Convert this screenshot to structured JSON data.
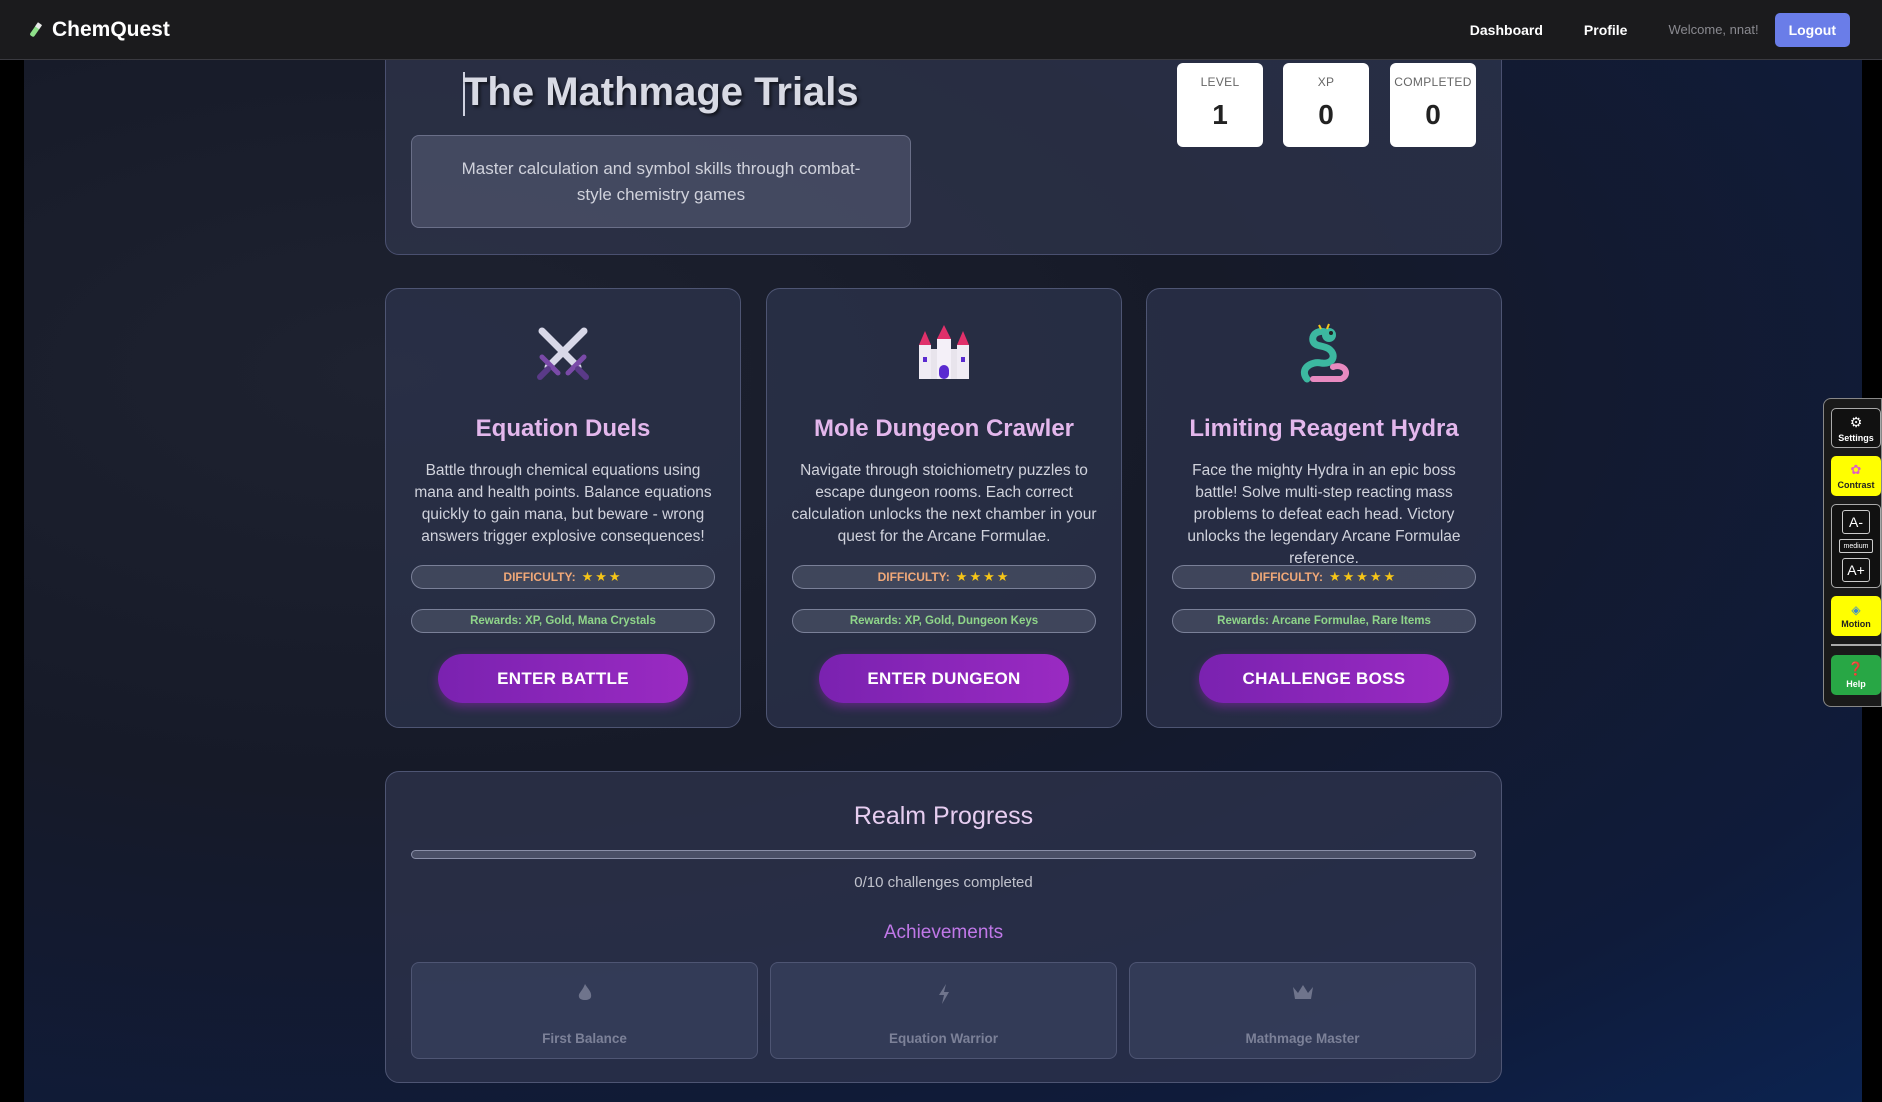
{
  "nav": {
    "brand": "ChemQuest",
    "links": [
      "Dashboard",
      "Profile"
    ],
    "welcome": "Welcome, nnat!",
    "logout": "Logout"
  },
  "header": {
    "title": "The Mathmage Trials",
    "subtitle": "Master calculation and symbol skills through combat-style chemistry games",
    "stats": [
      {
        "label": "LEVEL",
        "value": "1"
      },
      {
        "label": "XP",
        "value": "0"
      },
      {
        "label": "COMPLETED",
        "value": "0"
      }
    ]
  },
  "cards": [
    {
      "icon": "crossed-swords-icon",
      "title": "Equation Duels",
      "description": "Battle through chemical equations using mana and health points. Balance equations quickly to gain mana, but beware - wrong answers trigger explosive consequences!",
      "difficulty_label": "DIFFICULTY:",
      "difficulty_stars": 3,
      "rewards": "Rewards: XP, Gold, Mana Crystals",
      "button": "ENTER BATTLE"
    },
    {
      "icon": "castle-icon",
      "title": "Mole Dungeon Crawler",
      "description": "Navigate through stoichiometry puzzles to escape dungeon rooms. Each correct calculation unlocks the next chamber in your quest for the Arcane Formulae.",
      "difficulty_label": "DIFFICULTY:",
      "difficulty_stars": 4,
      "rewards": "Rewards: XP, Gold, Dungeon Keys",
      "button": "ENTER DUNGEON"
    },
    {
      "icon": "dragon-icon",
      "title": "Limiting Reagent Hydra",
      "description": "Face the mighty Hydra in an epic boss battle! Solve multi-step reacting mass problems to defeat each head. Victory unlocks the legendary Arcane Formulae reference.",
      "difficulty_label": "DIFFICULTY:",
      "difficulty_stars": 5,
      "rewards": "Rewards: Arcane Formulae, Rare Items",
      "button": "CHALLENGE BOSS"
    }
  ],
  "progress": {
    "title": "Realm Progress",
    "completed": 0,
    "total": 10,
    "text": "0/10 challenges completed",
    "achievements_title": "Achievements",
    "achievements": [
      {
        "icon": "flame-icon",
        "label": "First Balance"
      },
      {
        "icon": "lightning-icon",
        "label": "Equation Warrior"
      },
      {
        "icon": "crown-icon",
        "label": "Mathmage Master"
      }
    ]
  },
  "a11y": {
    "settings": "Settings",
    "contrast": "Contrast",
    "font_decrease": "A-",
    "font_size": "medium",
    "font_increase": "A+",
    "motion": "Motion",
    "help": "Help"
  },
  "colors": {
    "accent": "#9a2ac2",
    "card_title": "#e3b7ec",
    "logout": "#6a7de8",
    "help": "#28a745",
    "highlight_yellow": "#ffff00"
  }
}
